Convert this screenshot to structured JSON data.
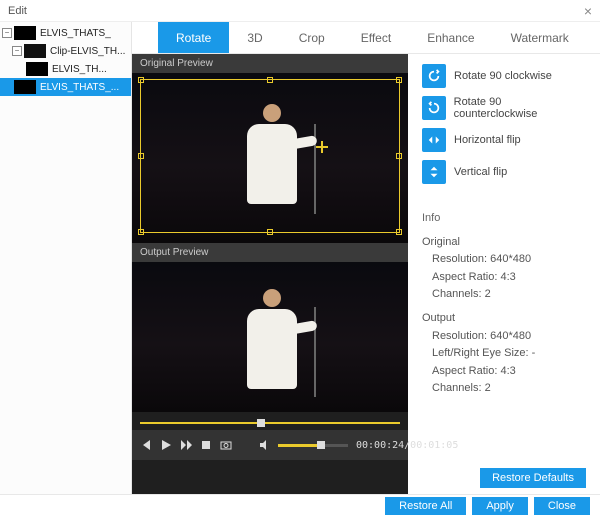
{
  "title": "Edit",
  "tree": {
    "root": "ELVIS_THATS_",
    "clip": "Clip-ELVIS_TH...",
    "child": "ELVIS_TH...",
    "selected": "ELVIS_THATS_..."
  },
  "tabs": [
    "Rotate",
    "3D",
    "Crop",
    "Effect",
    "Enhance",
    "Watermark"
  ],
  "preview": {
    "original_label": "Original Preview",
    "output_label": "Output Preview"
  },
  "controls": {
    "time": "00:00:24/00:01:05"
  },
  "rotate": {
    "cw": "Rotate 90 clockwise",
    "ccw": "Rotate 90 counterclockwise",
    "hflip": "Horizontal flip",
    "vflip": "Vertical flip"
  },
  "info": {
    "header": "Info",
    "original_label": "Original",
    "original": {
      "resolution": "Resolution: 640*480",
      "aspect": "Aspect Ratio: 4:3",
      "channels": "Channels: 2"
    },
    "output_label": "Output",
    "output": {
      "resolution": "Resolution: 640*480",
      "eye": "Left/Right Eye Size: -",
      "aspect": "Aspect Ratio: 4:3",
      "channels": "Channels: 2"
    }
  },
  "buttons": {
    "restore_defaults": "Restore Defaults",
    "restore_all": "Restore All",
    "apply": "Apply",
    "close": "Close"
  }
}
